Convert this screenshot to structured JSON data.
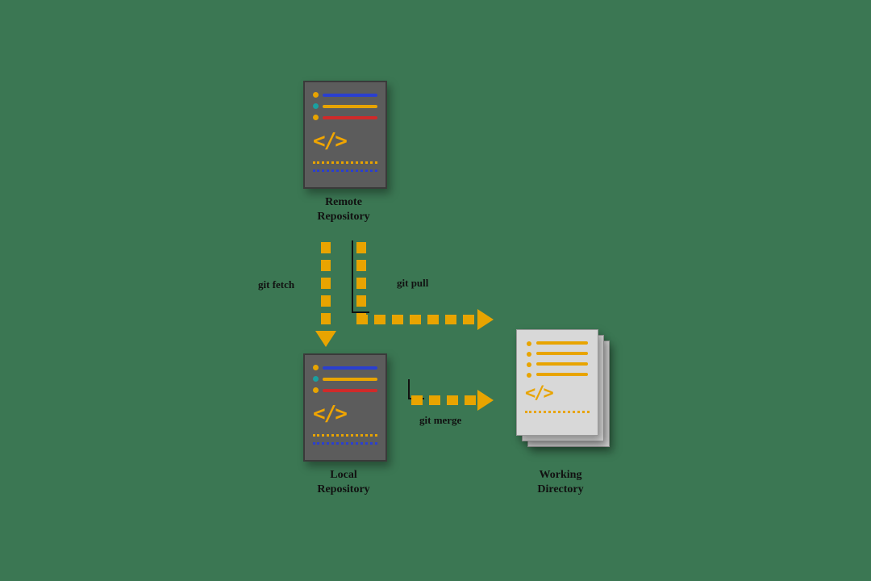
{
  "nodes": {
    "remote": {
      "label": "Remote\nRepository"
    },
    "local": {
      "label": "Local\nRepository"
    },
    "wd": {
      "label": "Working\nDirectory"
    }
  },
  "arrows": {
    "fetch": {
      "label": "git fetch"
    },
    "pull": {
      "label": "git pull"
    },
    "merge": {
      "label": "git merge"
    }
  },
  "colors": {
    "accent": "#e8a400",
    "blue": "#2a3fd0",
    "teal": "#1aa0a0",
    "red": "#d02a2a"
  }
}
